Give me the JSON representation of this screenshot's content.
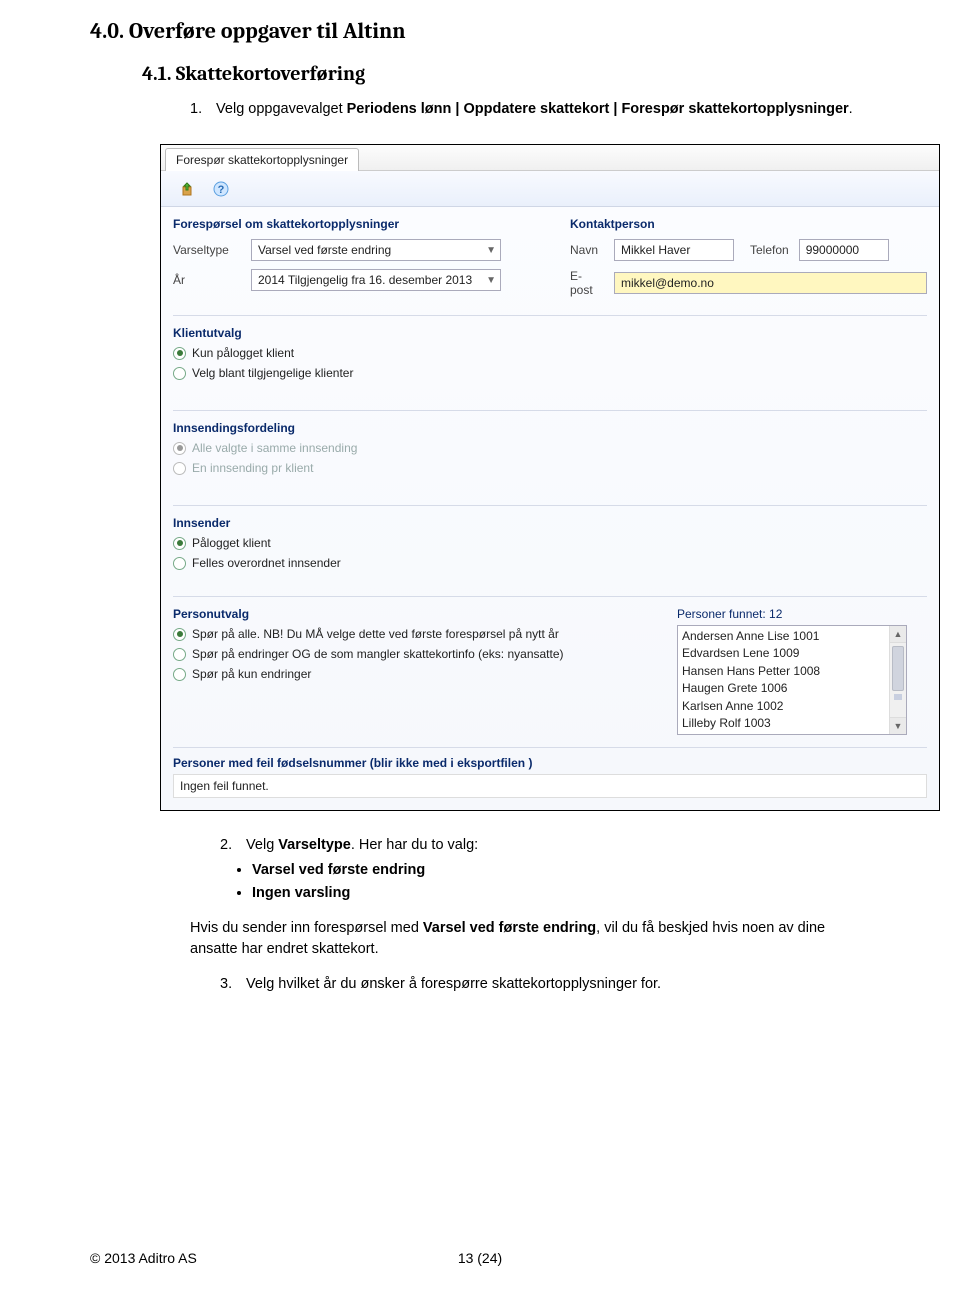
{
  "headings": {
    "h1": "4.0. Overføre oppgaver til Altinn",
    "h2": "4.1. Skattekortoverføring"
  },
  "step1": {
    "num": "1.",
    "pre": "Velg oppgavevalget ",
    "bold": "Periodens lønn | Oppdatere skattekort | Forespør skattekortopplysninger",
    "post": "."
  },
  "ui": {
    "tab": "Forespør skattekortopplysninger",
    "section_left": "Forespørsel om skattekortopplysninger",
    "section_right": "Kontaktperson",
    "labels": {
      "varseltype": "Varseltype",
      "aar": "År",
      "navn": "Navn",
      "telefon": "Telefon",
      "epost": "E-post"
    },
    "values": {
      "varseltype": "Varsel ved første endring",
      "aar": "2014 Tilgjengelig fra 16. desember 2013",
      "navn": "Mikkel Haver",
      "telefon": "99000000",
      "epost": "mikkel@demo.no"
    },
    "groups": {
      "klientutvalg": {
        "title": "Klientutvalg",
        "opt1": "Kun pålogget klient",
        "opt2": "Velg blant tilgjengelige klienter"
      },
      "innsendingsfordeling": {
        "title": "Innsendingsfordeling",
        "opt1": "Alle valgte i samme innsending",
        "opt2": "En innsending pr klient"
      },
      "innsender": {
        "title": "Innsender",
        "opt1": "Pålogget klient",
        "opt2": "Felles overordnet innsender"
      },
      "personutvalg": {
        "title": "Personutvalg",
        "opt1": "Spør på alle. NB! Du MÅ velge dette ved første forespørsel på nytt år",
        "opt2": "Spør på endringer OG de som mangler skattekortinfo (eks: nyansatte)",
        "opt3": "Spør på kun endringer"
      }
    },
    "persons": {
      "title": "Personer funnet:  12",
      "list": [
        "Andersen Anne Lise 1001",
        "Edvardsen Lene 1009",
        "Hansen Hans Petter 1008",
        "Haugen Grete 1006",
        "Karlsen Anne 1002",
        "Lilleby Rolf 1003"
      ]
    },
    "errors": {
      "title": "Personer med feil fødselsnummer (blir ikke med i eksportfilen )",
      "body": "Ingen feil funnet."
    }
  },
  "step2": {
    "num": "2.",
    "pre": "Velg ",
    "bold1": "Varseltype",
    "mid": ". Her har du to valg:",
    "b1": "Varsel ved første endring",
    "b2": "Ingen varsling"
  },
  "para1": {
    "pre": "Hvis du sender inn forespørsel med ",
    "bold": "Varsel ved første endring",
    "post": ", vil du få beskjed hvis noen av dine ansatte har endret skattekort."
  },
  "step3": {
    "num": "3.",
    "text": "Velg hvilket år du ønsker å forespørre skattekortopplysninger for."
  },
  "footer": {
    "copyright": "© 2013 Aditro AS",
    "page": "13 (24)"
  }
}
